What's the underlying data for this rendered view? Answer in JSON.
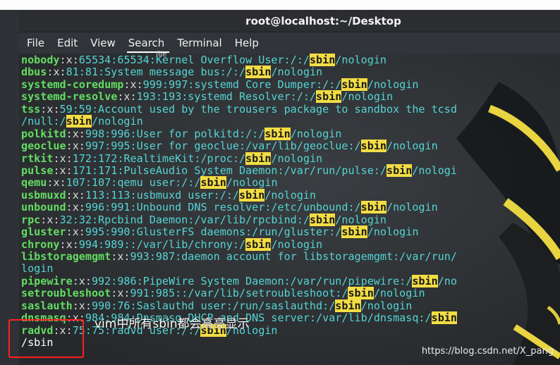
{
  "window": {
    "title": "root@localhost:~/Desktop"
  },
  "menu": [
    "File",
    "Edit",
    "View",
    "Search",
    "Terminal",
    "Help"
  ],
  "tooltip": "file",
  "terminal": {
    "lines": [
      [
        {
          "t": "nobody",
          "c": "user"
        },
        {
          "t": ":x:",
          "c": "sep"
        },
        {
          "t": "65534:65534:Kernel Overflow User:/:/",
          "c": "plain"
        },
        {
          "t": "sbin",
          "c": "hl"
        },
        {
          "t": "/nologin",
          "c": "plain"
        }
      ],
      [
        {
          "t": "dbus",
          "c": "user"
        },
        {
          "t": ":x:",
          "c": "sep"
        },
        {
          "t": "81:81:System message bus:/:/",
          "c": "plain"
        },
        {
          "t": "sbin",
          "c": "hl"
        },
        {
          "t": "/nologin",
          "c": "plain"
        }
      ],
      [
        {
          "t": "systemd-coredump",
          "c": "user"
        },
        {
          "t": ":x:",
          "c": "sep"
        },
        {
          "t": "999:997:systemd Core Dumper:/:/",
          "c": "plain"
        },
        {
          "t": "sbin",
          "c": "hl"
        },
        {
          "t": "/nologin",
          "c": "plain"
        }
      ],
      [
        {
          "t": "systemd-resolve",
          "c": "user"
        },
        {
          "t": ":x:",
          "c": "sep"
        },
        {
          "t": "193:193:systemd Resolver:/:/",
          "c": "plain"
        },
        {
          "t": "sbin",
          "c": "hl"
        },
        {
          "t": "/nologin",
          "c": "plain"
        }
      ],
      [
        {
          "t": "tss",
          "c": "user"
        },
        {
          "t": ":x:",
          "c": "sep"
        },
        {
          "t": "59:59:Account used by the trousers package to sandbox the tcsd",
          "c": "plain"
        }
      ],
      [
        {
          "t": "/null:/",
          "c": "plain"
        },
        {
          "t": "sbin",
          "c": "hl"
        },
        {
          "t": "/nologin",
          "c": "plain"
        }
      ],
      [
        {
          "t": "polkitd",
          "c": "user"
        },
        {
          "t": ":x:",
          "c": "sep"
        },
        {
          "t": "998:996:User for polkitd:/:/",
          "c": "plain"
        },
        {
          "t": "sbin",
          "c": "hl"
        },
        {
          "t": "/nologin",
          "c": "plain"
        }
      ],
      [
        {
          "t": "geoclue",
          "c": "user"
        },
        {
          "t": ":x:",
          "c": "sep"
        },
        {
          "t": "997:995:User for geoclue:/var/lib/geoclue:/",
          "c": "plain"
        },
        {
          "t": "sbin",
          "c": "hl"
        },
        {
          "t": "/nologin",
          "c": "plain"
        }
      ],
      [
        {
          "t": "rtkit",
          "c": "user"
        },
        {
          "t": ":x:",
          "c": "sep"
        },
        {
          "t": "172:172:RealtimeKit:/proc:/",
          "c": "plain"
        },
        {
          "t": "sbin",
          "c": "hl"
        },
        {
          "t": "/nologin",
          "c": "plain"
        }
      ],
      [
        {
          "t": "pulse",
          "c": "user"
        },
        {
          "t": ":x:",
          "c": "sep"
        },
        {
          "t": "171:171:PulseAudio System Daemon:/var/run/pulse:/",
          "c": "plain"
        },
        {
          "t": "sbin",
          "c": "hl"
        },
        {
          "t": "/nologi",
          "c": "plain"
        }
      ],
      [
        {
          "t": "qemu",
          "c": "user"
        },
        {
          "t": ":x:",
          "c": "sep"
        },
        {
          "t": "107:107:qemu user:/:/",
          "c": "plain"
        },
        {
          "t": "sbin",
          "c": "hl"
        },
        {
          "t": "/nologin",
          "c": "plain"
        }
      ],
      [
        {
          "t": "usbmuxd",
          "c": "user"
        },
        {
          "t": ":x:",
          "c": "sep"
        },
        {
          "t": "113:113:usbmuxd user:/:/",
          "c": "plain"
        },
        {
          "t": "sbin",
          "c": "hl"
        },
        {
          "t": "/nologin",
          "c": "plain"
        }
      ],
      [
        {
          "t": "unbound",
          "c": "user"
        },
        {
          "t": ":x:",
          "c": "sep"
        },
        {
          "t": "996:991:Unbound DNS resolver:/etc/unbound:/",
          "c": "plain"
        },
        {
          "t": "sbin",
          "c": "hl"
        },
        {
          "t": "/nologin",
          "c": "plain"
        }
      ],
      [
        {
          "t": "rpc",
          "c": "user"
        },
        {
          "t": ":x:",
          "c": "sep"
        },
        {
          "t": "32:32:Rpcbind Daemon:/var/lib/rpcbind:/",
          "c": "plain"
        },
        {
          "t": "sbin",
          "c": "hl"
        },
        {
          "t": "/nologin",
          "c": "plain"
        }
      ],
      [
        {
          "t": "gluster",
          "c": "user"
        },
        {
          "t": ":x:",
          "c": "sep"
        },
        {
          "t": "995:990:GlusterFS daemons:/run/gluster:/",
          "c": "plain"
        },
        {
          "t": "sbin",
          "c": "hl"
        },
        {
          "t": "/nologin",
          "c": "plain"
        }
      ],
      [
        {
          "t": "chrony",
          "c": "user"
        },
        {
          "t": ":x:",
          "c": "sep"
        },
        {
          "t": "994:989::/var/lib/chrony:/",
          "c": "plain"
        },
        {
          "t": "sbin",
          "c": "hl"
        },
        {
          "t": "/nologin",
          "c": "plain"
        }
      ],
      [
        {
          "t": "libstoragemgmt",
          "c": "user"
        },
        {
          "t": ":x:",
          "c": "sep"
        },
        {
          "t": "993:987:daemon account for libstoragemgmt:/var/run/",
          "c": "plain"
        }
      ],
      [
        {
          "t": "login",
          "c": "plain"
        }
      ],
      [
        {
          "t": "pipewire",
          "c": "user"
        },
        {
          "t": ":x:",
          "c": "sep"
        },
        {
          "t": "992:986:PipeWire System Daemon:/var/run/pipewire:/",
          "c": "plain"
        },
        {
          "t": "sbin",
          "c": "hl"
        },
        {
          "t": "/no",
          "c": "plain"
        }
      ],
      [
        {
          "t": "setroubleshoot",
          "c": "user"
        },
        {
          "t": ":x:",
          "c": "sep"
        },
        {
          "t": "991:985::/var/lib/setroubleshoot:/",
          "c": "plain"
        },
        {
          "t": "sbin",
          "c": "hl"
        },
        {
          "t": "/nologin",
          "c": "plain"
        }
      ],
      [
        {
          "t": "saslauth",
          "c": "user"
        },
        {
          "t": ":x:",
          "c": "sep"
        },
        {
          "t": "990:76:Saslauthd user:/run/saslauthd:/",
          "c": "plain"
        },
        {
          "t": "sbin",
          "c": "hl"
        },
        {
          "t": "/nologin",
          "c": "plain"
        }
      ],
      [
        {
          "t": "dnsmasq",
          "c": "user"
        },
        {
          "t": ":x:",
          "c": "sep"
        },
        {
          "t": "984:984:Dnsmasq DHCP and DNS server:/var/lib/dnsmasq:/",
          "c": "plain"
        },
        {
          "t": "sbin",
          "c": "hl"
        }
      ],
      [
        {
          "t": "radvd",
          "c": "user"
        },
        {
          "t": ":x:",
          "c": "sep"
        },
        {
          "t": "75:75:radvd user:/:/",
          "c": "plain"
        },
        {
          "t": "sbin",
          "c": "hl"
        },
        {
          "t": "/nologin",
          "c": "plain"
        }
      ],
      [
        {
          "t": "/sbin",
          "c": "prompt"
        }
      ]
    ]
  },
  "annotation": "vim中所有sbin都会高亮显示",
  "watermark": "https://blog.csdn.net/X_pang",
  "colors": {
    "username": "#63dd63",
    "text": "#54d4d4",
    "highlight": "#f3dd43"
  }
}
